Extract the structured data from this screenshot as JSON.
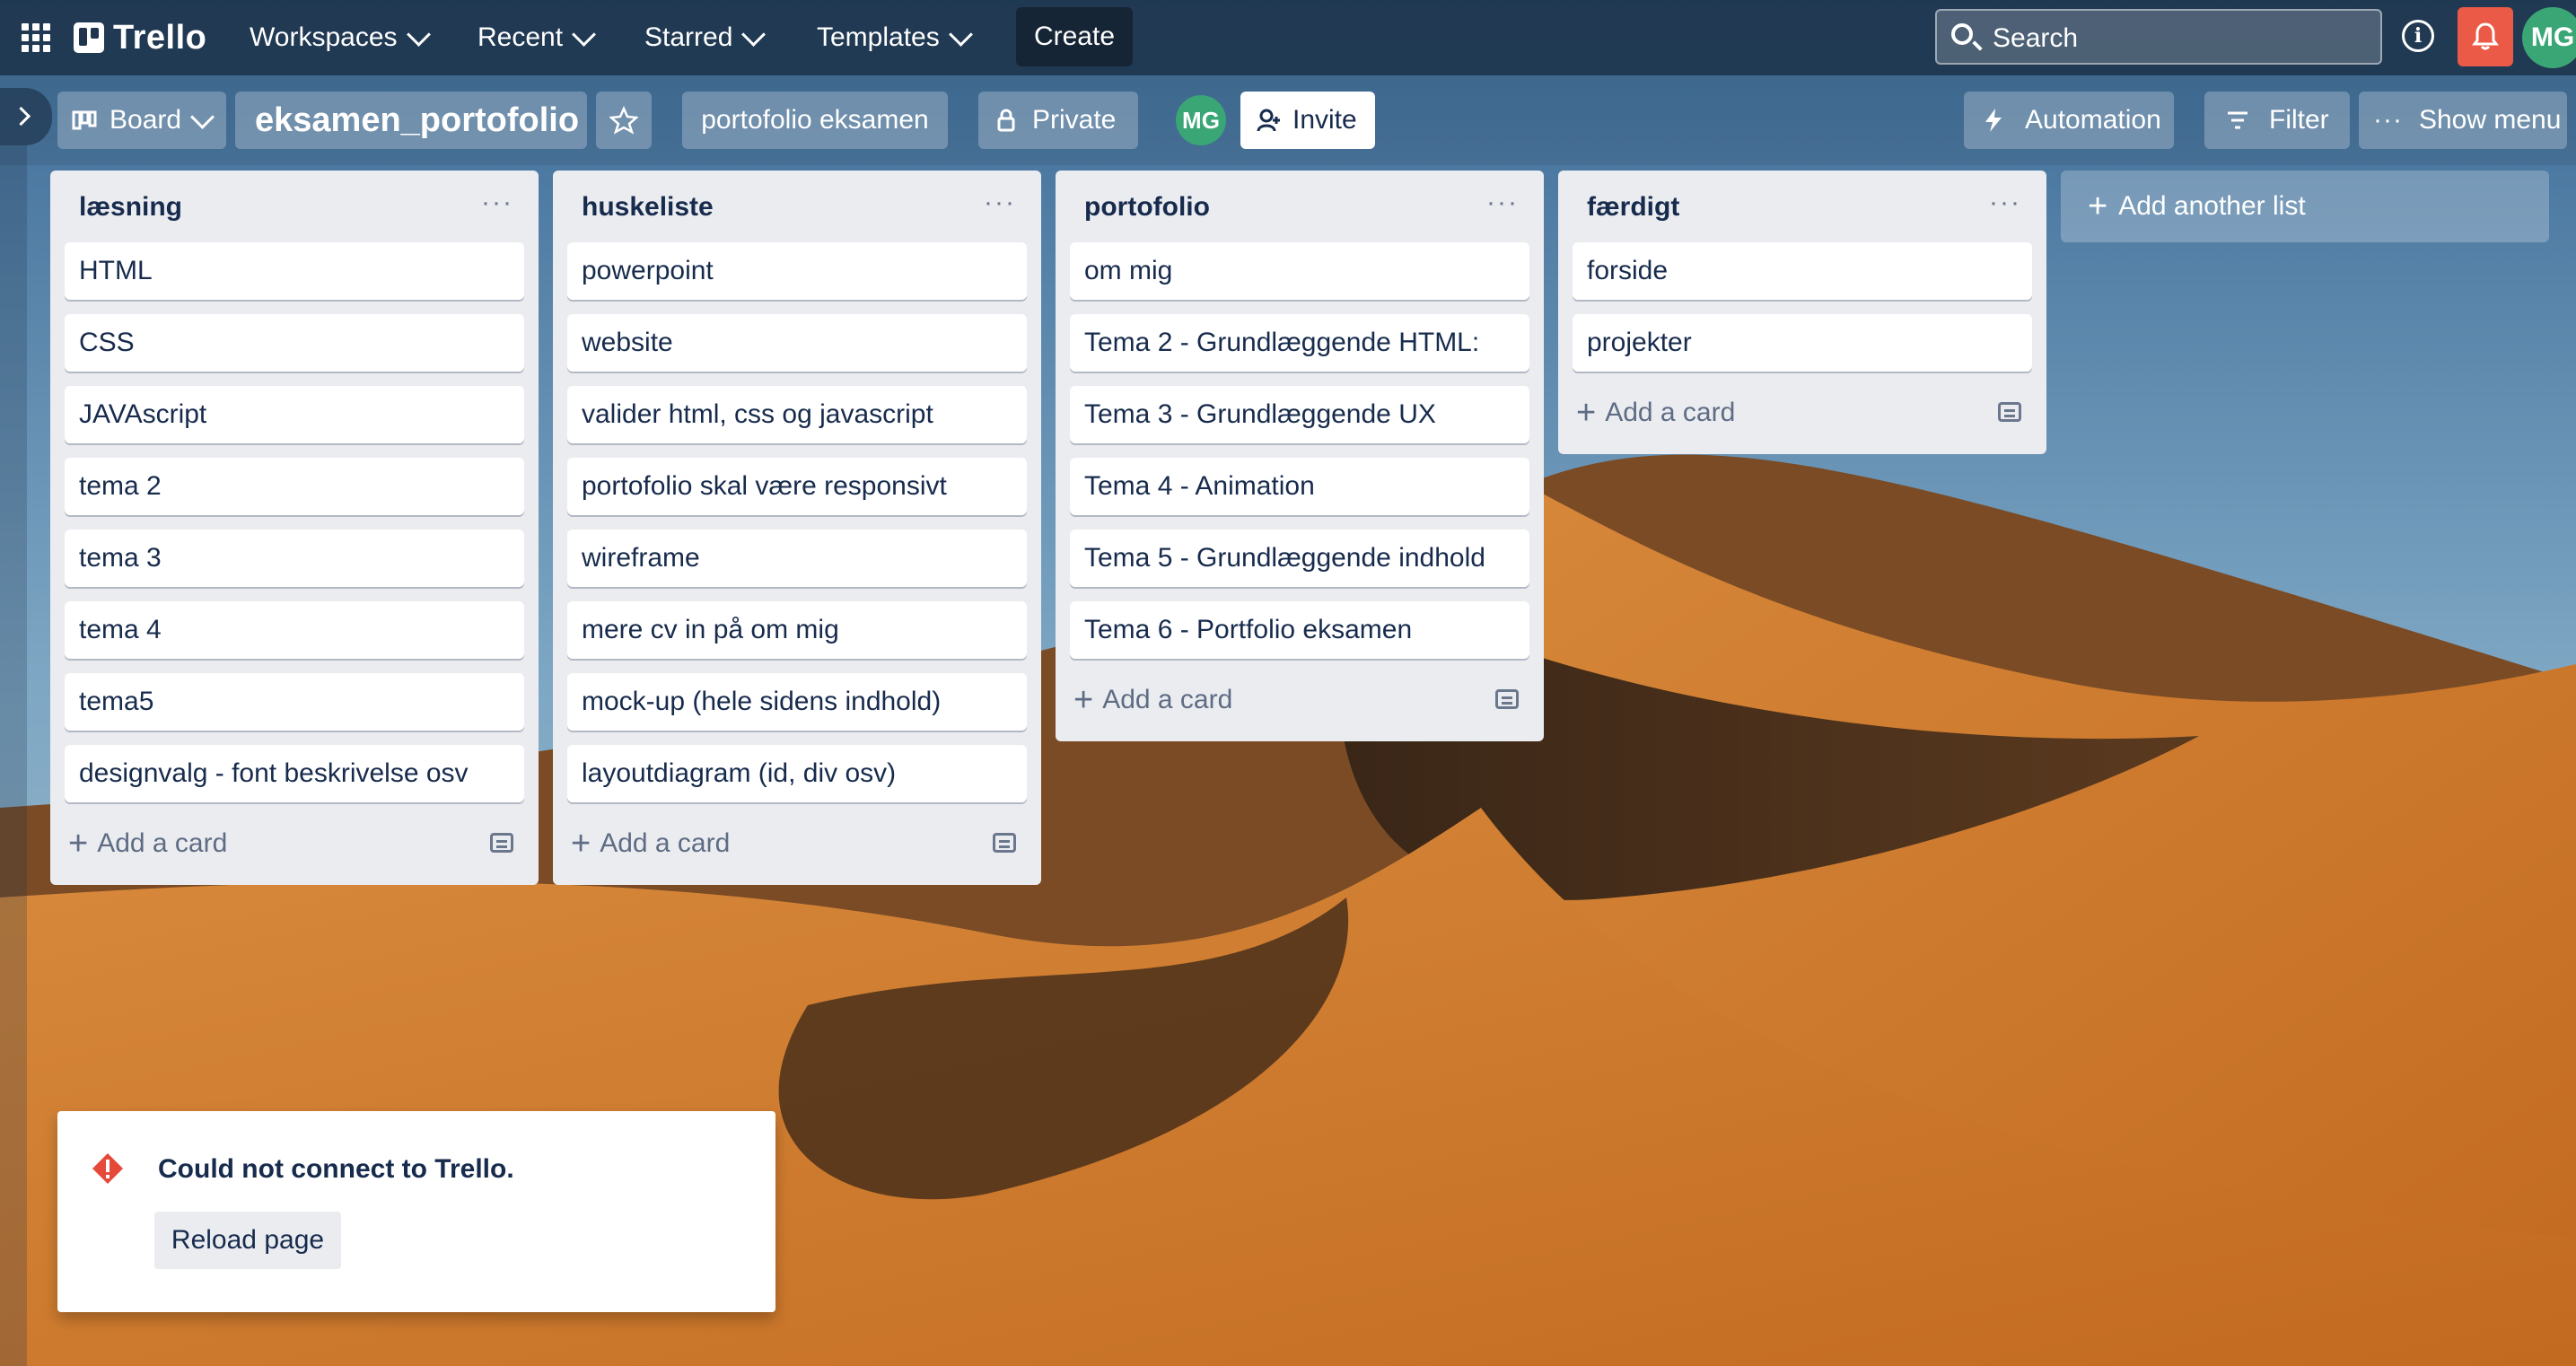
{
  "header": {
    "logo_text": "Trello",
    "nav": [
      {
        "label": "Workspaces"
      },
      {
        "label": "Recent"
      },
      {
        "label": "Starred"
      },
      {
        "label": "Templates"
      }
    ],
    "create_label": "Create",
    "search_placeholder": "Search",
    "avatar_initials": "MG"
  },
  "board_header": {
    "view_label": "Board",
    "title": "eksamen_portofolio",
    "workspace_label": "portofolio eksamen",
    "visibility_label": "Private",
    "member_initials": "MG",
    "invite_label": "Invite",
    "automation_label": "Automation",
    "filter_label": "Filter",
    "show_menu_label": "Show menu"
  },
  "lists": [
    {
      "title": "læsning",
      "cards": [
        "HTML",
        "CSS",
        "JAVAscript",
        "tema 2",
        "tema 3",
        "tema 4",
        "tema5",
        "designvalg - font beskrivelse osv"
      ],
      "add_card_label": "Add a card"
    },
    {
      "title": "huskeliste",
      "cards": [
        "powerpoint",
        "website",
        "valider html, css og javascript",
        "portofolio skal være responsivt",
        "wireframe",
        "mere cv in på om mig",
        "mock-up (hele sidens indhold)",
        "layoutdiagram (id, div osv)"
      ],
      "add_card_label": "Add a card"
    },
    {
      "title": "portofolio",
      "cards": [
        "om mig",
        "Tema 2 - Grundlæggende HTML:",
        "Tema 3 - Grundlæggende UX",
        "Tema 4 - Animation",
        "Tema 5 - Grundlæggende indhold",
        "Tema 6 - Portfolio eksamen"
      ],
      "add_card_label": "Add a card"
    },
    {
      "title": "færdigt",
      "cards": [
        "forside",
        "projekter"
      ],
      "add_card_label": "Add a card"
    }
  ],
  "add_list_label": "Add another list",
  "toast": {
    "message": "Could not connect to Trello.",
    "button_label": "Reload page"
  },
  "colors": {
    "header_bg": "#1e354d",
    "notification_red": "#eb5a46",
    "avatar_green": "#3aa676",
    "list_bg": "#ebecf0",
    "error_red": "#e5493a"
  }
}
